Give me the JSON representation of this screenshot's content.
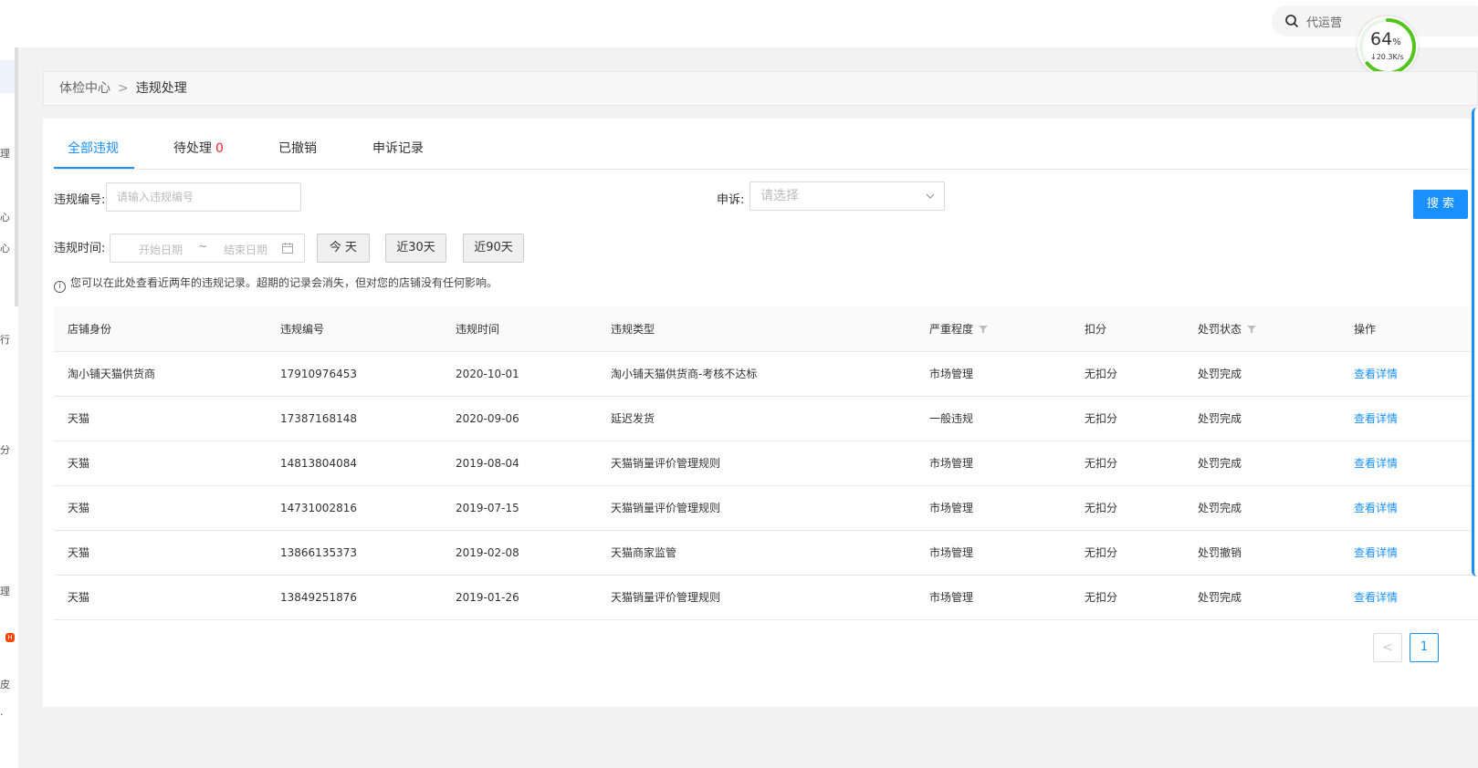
{
  "topbar": {
    "search_text": "代运营"
  },
  "speed_widget": {
    "percent": "64",
    "percent_sign": "%",
    "rate": "↓20.3K/s",
    "level": 0.64
  },
  "sidebar": {
    "glyphs": [
      "理",
      "心",
      "心",
      "行",
      "分",
      "理",
      "皮",
      "·"
    ],
    "badge": "H"
  },
  "breadcrumb": {
    "root": "体检中心",
    "separator": ">",
    "current": "违规处理"
  },
  "tabs": [
    {
      "label": "全部违规",
      "active": true
    },
    {
      "label": "待处理",
      "count": "0"
    },
    {
      "label": "已撤销"
    },
    {
      "label": "申诉记录"
    }
  ],
  "filters": {
    "id_label": "违规编号:",
    "id_placeholder": "请输入违规编号",
    "appeal_label": "申诉:",
    "appeal_placeholder": "请选择",
    "search_label": "搜 索",
    "time_label": "违规时间:",
    "start_placeholder": "开始日期",
    "range_sep": "~",
    "end_placeholder": "结束日期",
    "quick": [
      "今 天",
      "近30天",
      "近90天"
    ]
  },
  "notice": "您可以在此处查看近两年的违规记录。超期的记录会消失，但对您的店铺没有任何影响。",
  "table": {
    "columns": [
      "店铺身份",
      "违规编号",
      "违规时间",
      "违规类型",
      "严重程度",
      "扣分",
      "处罚状态",
      "操作"
    ],
    "rows": [
      [
        "淘小铺天猫供货商",
        "17910976453",
        "2020-10-01",
        "淘小铺天猫供货商-考核不达标",
        "市场管理",
        "无扣分",
        "处罚完成",
        "查看详情"
      ],
      [
        "天猫",
        "17387168148",
        "2020-09-06",
        "延迟发货",
        "一般违规",
        "无扣分",
        "处罚完成",
        "查看详情"
      ],
      [
        "天猫",
        "14813804084",
        "2019-08-04",
        "天猫销量评价管理规则",
        "市场管理",
        "无扣分",
        "处罚完成",
        "查看详情"
      ],
      [
        "天猫",
        "14731002816",
        "2019-07-15",
        "天猫销量评价管理规则",
        "市场管理",
        "无扣分",
        "处罚完成",
        "查看详情"
      ],
      [
        "天猫",
        "13866135373",
        "2019-02-08",
        "天猫商家监管",
        "市场管理",
        "无扣分",
        "处罚撤销",
        "查看详情"
      ],
      [
        "天猫",
        "13849251876",
        "2019-01-26",
        "天猫销量评价管理规则",
        "市场管理",
        "无扣分",
        "处罚完成",
        "查看详情"
      ]
    ]
  },
  "pagination": {
    "prev": "<",
    "current": "1"
  },
  "colors": {
    "primary": "#1890ff",
    "danger": "#f5222d",
    "ring": "#52c41a"
  }
}
